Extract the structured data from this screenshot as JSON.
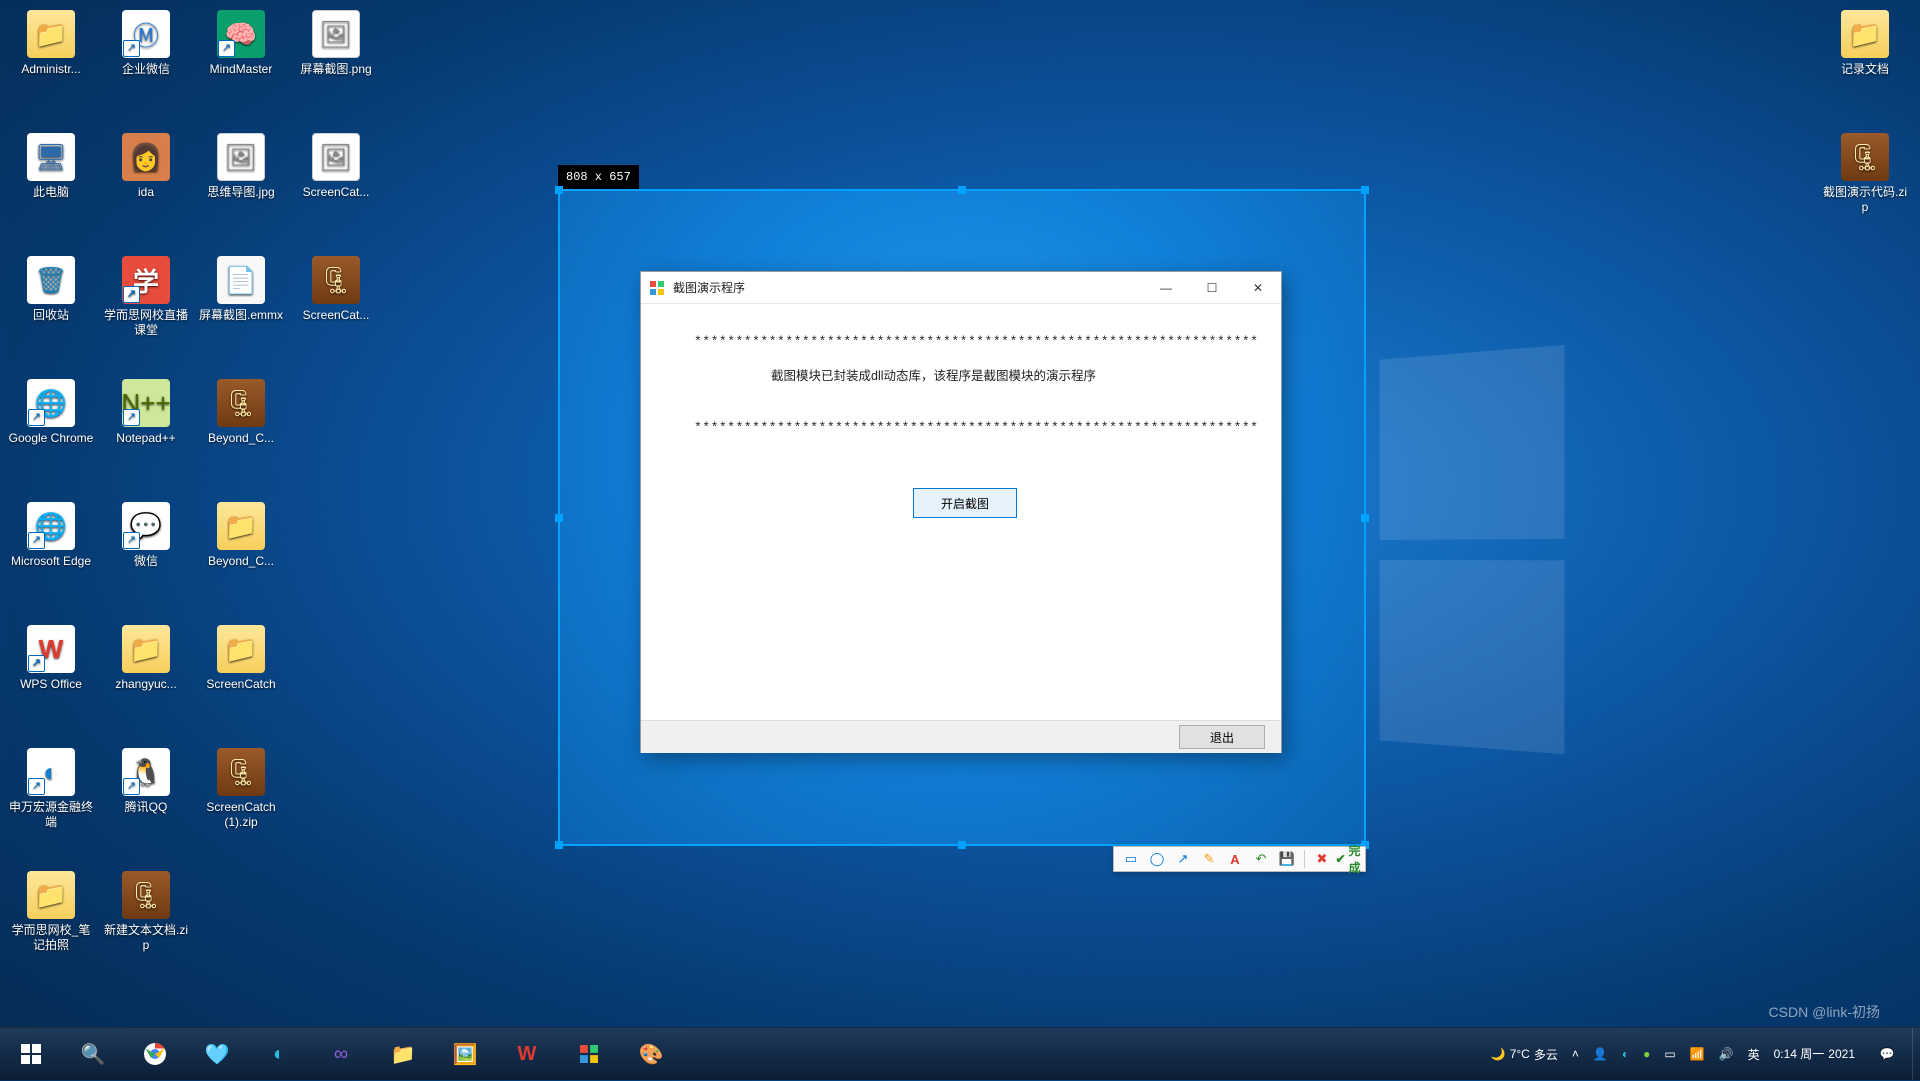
{
  "wallpaper_logo": "windows",
  "desktop_icons": [
    {
      "label": "Administr...",
      "kind": "folder",
      "col": 0,
      "row": 0,
      "shortcut": false
    },
    {
      "label": "企业微信",
      "kind": "qywx",
      "col": 1,
      "row": 0,
      "shortcut": true
    },
    {
      "label": "MindMaster",
      "kind": "mind",
      "col": 2,
      "row": 0,
      "shortcut": true
    },
    {
      "label": "屏幕截图.png",
      "kind": "img",
      "col": 3,
      "row": 0,
      "shortcut": false
    },
    {
      "label": "此电脑",
      "kind": "computer",
      "col": 0,
      "row": 1,
      "shortcut": false
    },
    {
      "label": "ida",
      "kind": "ida",
      "col": 1,
      "row": 1,
      "shortcut": false
    },
    {
      "label": "思维导图.jpg",
      "kind": "img",
      "col": 2,
      "row": 1,
      "shortcut": false
    },
    {
      "label": "ScreenCat...",
      "kind": "img",
      "col": 3,
      "row": 1,
      "shortcut": false
    },
    {
      "label": "回收站",
      "kind": "recycle",
      "col": 0,
      "row": 2,
      "shortcut": false
    },
    {
      "label": "学而思网校直播课堂",
      "kind": "xes",
      "col": 1,
      "row": 2,
      "shortcut": true
    },
    {
      "label": "屏幕截图.emmx",
      "kind": "text",
      "col": 2,
      "row": 2,
      "shortcut": false
    },
    {
      "label": "ScreenCat...",
      "kind": "zip",
      "col": 3,
      "row": 2,
      "shortcut": false
    },
    {
      "label": "Google Chrome",
      "kind": "chrome",
      "col": 0,
      "row": 3,
      "shortcut": true
    },
    {
      "label": "Notepad++",
      "kind": "notepadpp",
      "col": 1,
      "row": 3,
      "shortcut": true
    },
    {
      "label": "Beyond_C...",
      "kind": "zip",
      "col": 2,
      "row": 3,
      "shortcut": false
    },
    {
      "label": "Microsoft Edge",
      "kind": "edge",
      "col": 0,
      "row": 4,
      "shortcut": true
    },
    {
      "label": "微信",
      "kind": "wechat",
      "col": 1,
      "row": 4,
      "shortcut": true
    },
    {
      "label": "Beyond_C...",
      "kind": "folder",
      "col": 2,
      "row": 4,
      "shortcut": false
    },
    {
      "label": "WPS Office",
      "kind": "wps",
      "col": 0,
      "row": 5,
      "shortcut": true
    },
    {
      "label": "zhangyuc...",
      "kind": "folder",
      "col": 1,
      "row": 5,
      "shortcut": false
    },
    {
      "label": "ScreenCatch",
      "kind": "folder",
      "col": 2,
      "row": 5,
      "shortcut": false
    },
    {
      "label": "申万宏源金融终端",
      "kind": "blue",
      "col": 0,
      "row": 6,
      "shortcut": true
    },
    {
      "label": "腾讯QQ",
      "kind": "qq",
      "col": 1,
      "row": 6,
      "shortcut": true
    },
    {
      "label": "ScreenCatch (1).zip",
      "kind": "zip",
      "col": 2,
      "row": 6,
      "shortcut": false
    },
    {
      "label": "学而思网校_笔记拍照",
      "kind": "folder",
      "col": 0,
      "row": 7,
      "shortcut": false
    },
    {
      "label": "新建文本文档.zip",
      "kind": "zip",
      "col": 1,
      "row": 7,
      "shortcut": false
    },
    {
      "label": "记录文档",
      "kind": "folder",
      "col": -1,
      "row": 0,
      "shortcut": false,
      "right": true
    },
    {
      "label": "截图演示代码.zip",
      "kind": "zip",
      "col": -1,
      "row": 1,
      "shortcut": false,
      "right": true
    }
  ],
  "capture": {
    "size_label": "808 x 657"
  },
  "dialog": {
    "title": "截图演示程序",
    "asterisks": "********************************************************************",
    "message": "截图模块已封装成dll动态库，该程序是截图模块的演示程序",
    "primary_button": "开启截图",
    "exit_button": "退出"
  },
  "snip_toolbar": {
    "rect": "rect",
    "ellipse": "ellipse",
    "arrow": "arrow",
    "pen": "pen",
    "text": "text",
    "undo": "undo",
    "save": "save",
    "cancel": "cancel",
    "ok": "ok",
    "done_label": "完成"
  },
  "taskbar": {
    "weather_temp": "7°C",
    "weather_text": "多云",
    "ime": "英",
    "clock_time": "0:14 周一",
    "clock_date": "2021"
  },
  "watermark": "CSDN @link-初扬"
}
